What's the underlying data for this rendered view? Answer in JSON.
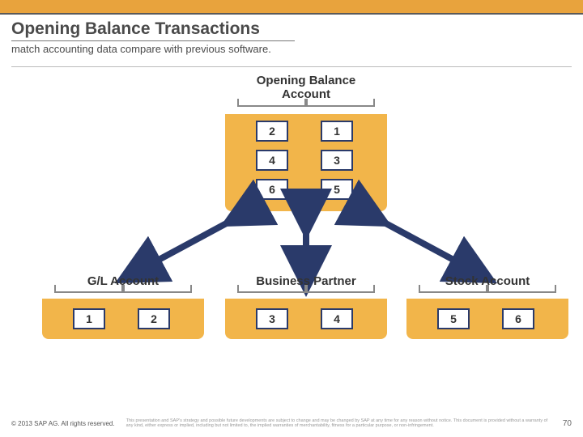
{
  "brand_bar_color": "#e8a33d",
  "header": {
    "title": "Opening Balance Transactions",
    "subtitle": "match accounting data compare with previous software."
  },
  "top_group": {
    "title_line1": "Opening Balance",
    "title_line2": "Account",
    "cells": [
      [
        "2",
        "1"
      ],
      [
        "4",
        "3"
      ],
      [
        "6",
        "5"
      ]
    ]
  },
  "bottom_groups": [
    {
      "title": "G/L Account",
      "cells": [
        "1",
        "2"
      ]
    },
    {
      "title": "Business Partner",
      "cells": [
        "3",
        "4"
      ]
    },
    {
      "title": "Stock Account",
      "cells": [
        "5",
        "6"
      ]
    }
  ],
  "footer": {
    "copyright": "© 2013 SAP AG. All rights reserved.",
    "legal": "This presentation and SAP's strategy and possible future developments are subject to change and may be changed by SAP at any time for any reason without notice. This document is provided without a warranty of any kind, either express or implied, including but not limited to, the implied warranties of merchantability, fitness for a particular purpose, or non-infringement.",
    "page": "70"
  }
}
